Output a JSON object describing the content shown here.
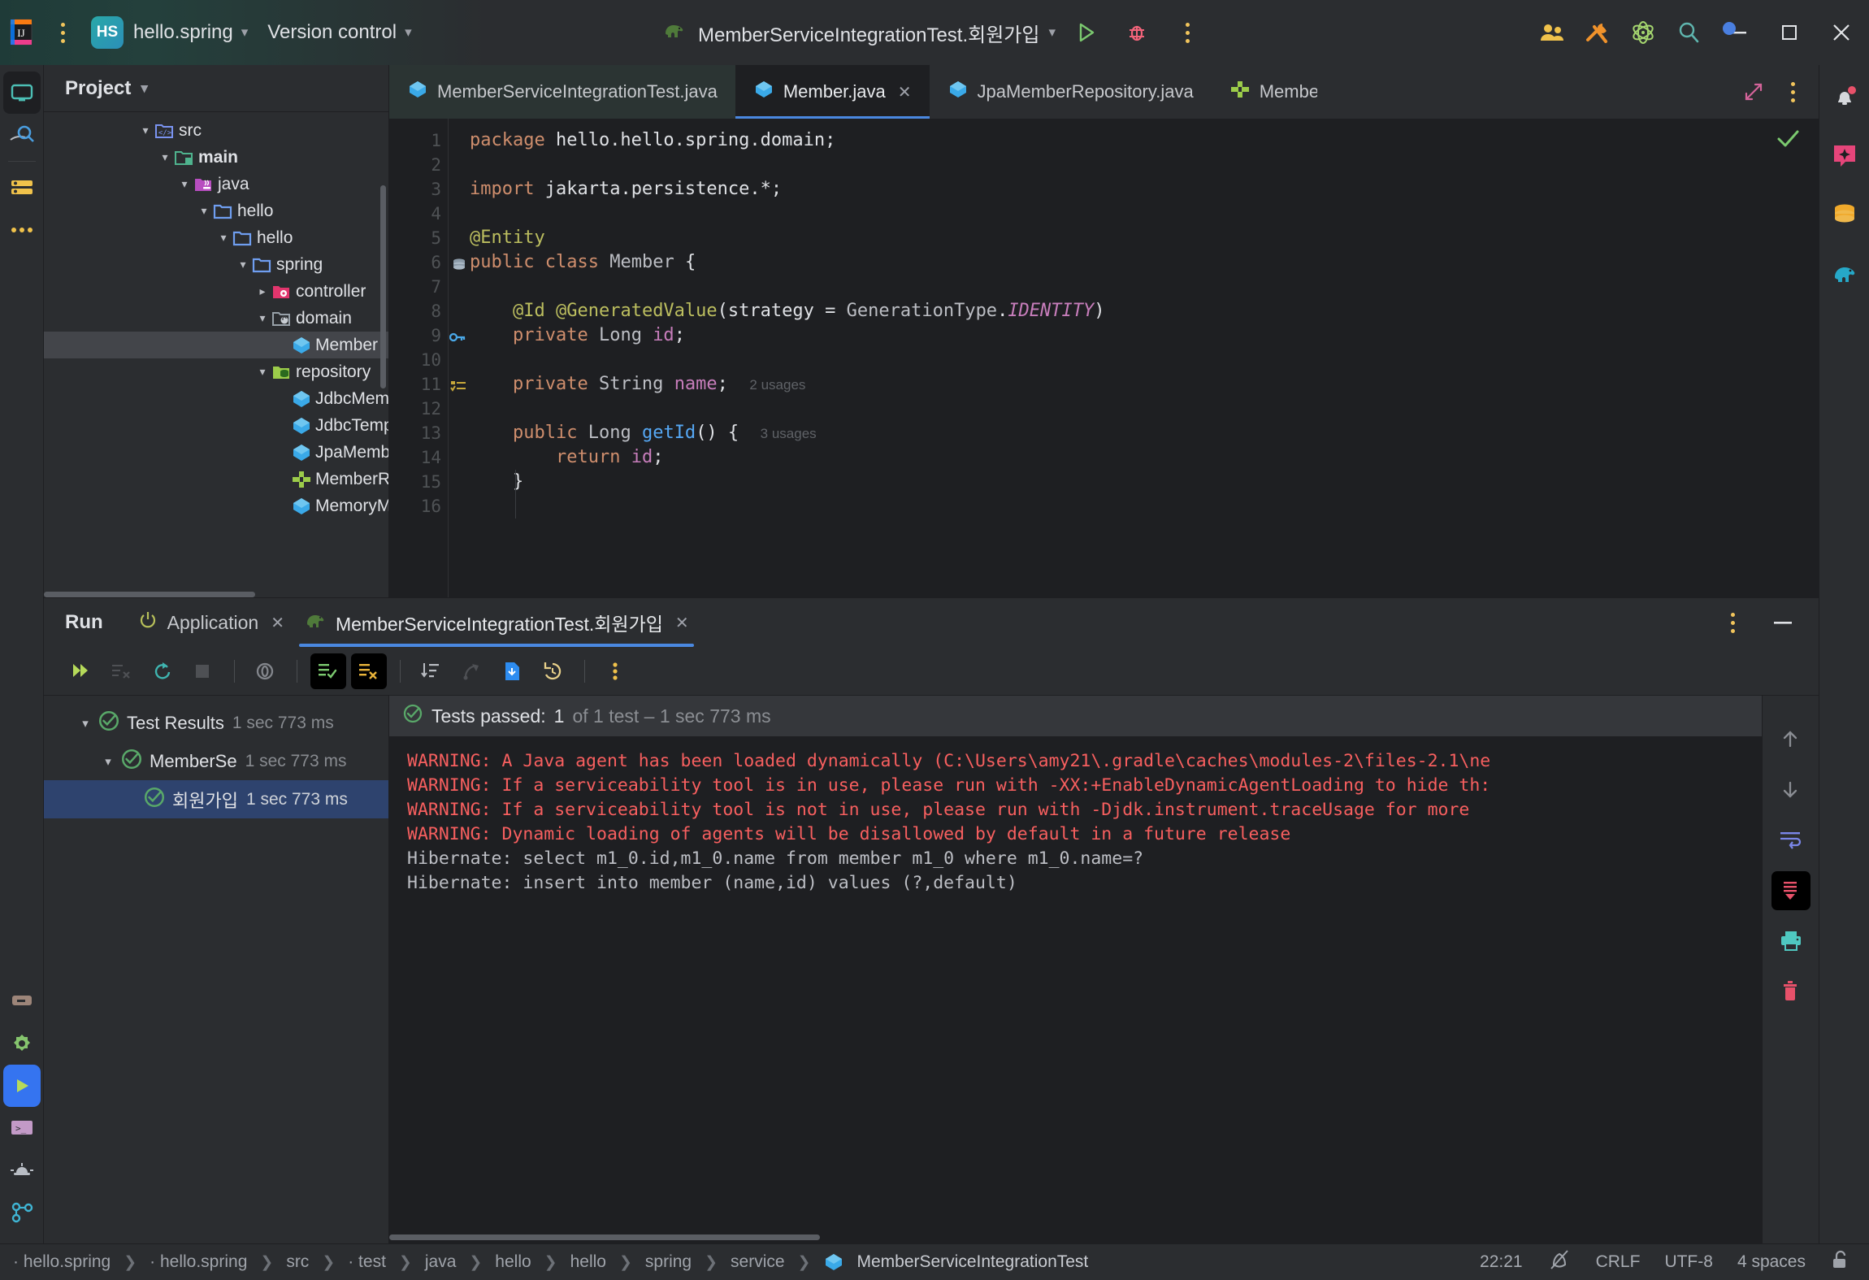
{
  "titlebar": {
    "project_initials": "HS",
    "project_name": "hello.spring",
    "version_control": "Version control",
    "run_config": "MemberServiceIntegrationTest.회원가입",
    "icons": {
      "app_logo": "intellij-logo-icon",
      "main_menu": "hamburger-menu-icon",
      "run": "run-icon",
      "debug": "debug-icon",
      "more": "more-vertical-icon",
      "collab": "collaborate-icon",
      "settings": "tools-icon",
      "plugin": "atom-plugin-icon",
      "search": "search-icon",
      "minimize": "minimize-icon",
      "maximize": "maximize-icon",
      "close": "close-icon"
    }
  },
  "project_panel": {
    "title": "Project",
    "tree": [
      {
        "label": "src",
        "indent": 4,
        "arrow": "down",
        "icon": "src-folder-icon",
        "bold": false,
        "selected": false
      },
      {
        "label": "main",
        "indent": 5,
        "arrow": "down",
        "icon": "main-folder-icon",
        "bold": true,
        "selected": false
      },
      {
        "label": "java",
        "indent": 6,
        "arrow": "down",
        "icon": "java-folder-icon",
        "bold": false,
        "selected": false
      },
      {
        "label": "hello",
        "indent": 7,
        "arrow": "down",
        "icon": "package-folder-icon",
        "bold": false,
        "selected": false
      },
      {
        "label": "hello",
        "indent": 8,
        "arrow": "down",
        "icon": "package-folder-icon",
        "bold": false,
        "selected": false
      },
      {
        "label": "spring",
        "indent": 9,
        "arrow": "down",
        "icon": "package-folder-icon",
        "bold": false,
        "selected": false
      },
      {
        "label": "controller",
        "indent": 10,
        "arrow": "right",
        "icon": "controller-folder-icon",
        "bold": false,
        "selected": false
      },
      {
        "label": "domain",
        "indent": 10,
        "arrow": "down",
        "icon": "domain-folder-icon",
        "bold": false,
        "selected": false
      },
      {
        "label": "Member",
        "indent": 11,
        "arrow": "none",
        "icon": "java-class-icon",
        "bold": false,
        "selected": true
      },
      {
        "label": "repository",
        "indent": 10,
        "arrow": "down",
        "icon": "repository-folder-icon",
        "bold": false,
        "selected": false
      },
      {
        "label": "JdbcMemberRepo",
        "indent": 11,
        "arrow": "none",
        "icon": "java-class-icon",
        "bold": false,
        "selected": false
      },
      {
        "label": "JdbcTemplateMem",
        "indent": 11,
        "arrow": "none",
        "icon": "java-class-icon",
        "bold": false,
        "selected": false
      },
      {
        "label": "JpaMemberRepos",
        "indent": 11,
        "arrow": "none",
        "icon": "java-class-icon",
        "bold": false,
        "selected": false
      },
      {
        "label": "MemberRepositor",
        "indent": 11,
        "arrow": "none",
        "icon": "java-interface-icon",
        "bold": false,
        "selected": false
      },
      {
        "label": "MemoryMemberR",
        "indent": 11,
        "arrow": "none",
        "icon": "java-class-icon",
        "bold": false,
        "selected": false
      }
    ]
  },
  "editor": {
    "tabs": [
      {
        "label": "MemberServiceIntegrationTest.java",
        "icon": "java-class-icon",
        "active": false,
        "modified_bg": true,
        "closable": false
      },
      {
        "label": "Member.java",
        "icon": "java-class-icon",
        "active": true,
        "modified_bg": false,
        "closable": true
      },
      {
        "label": "JpaMemberRepository.java",
        "icon": "java-class-icon",
        "active": false,
        "modified_bg": false,
        "closable": false
      },
      {
        "label": "MemberRepository.java",
        "icon": "java-interface-icon",
        "active": false,
        "modified_bg": false,
        "closable": false
      }
    ],
    "tab_actions": {
      "expand": "expand-editor-icon",
      "more": "more-vertical-icon"
    },
    "inspection_status": "green-checkmark-icon",
    "lines": [
      {
        "n": 1,
        "gutter": "",
        "text": "package hello.hello.spring.domain;"
      },
      {
        "n": 2,
        "gutter": "",
        "text": ""
      },
      {
        "n": 3,
        "gutter": "",
        "text": "import jakarta.persistence.*;"
      },
      {
        "n": 4,
        "gutter": "",
        "text": ""
      },
      {
        "n": 5,
        "gutter": "",
        "text": "@Entity"
      },
      {
        "n": 6,
        "gutter": "database-icon",
        "text": "public class Member {"
      },
      {
        "n": 7,
        "gutter": "",
        "text": ""
      },
      {
        "n": 8,
        "gutter": "",
        "text": "    @Id @GeneratedValue(strategy = GenerationType.IDENTITY)"
      },
      {
        "n": 9,
        "gutter": "key-icon",
        "text": "    private Long id;"
      },
      {
        "n": 10,
        "gutter": "",
        "text": ""
      },
      {
        "n": 11,
        "gutter": "column-icon",
        "text": "    private String name;",
        "usages": "2 usages"
      },
      {
        "n": 12,
        "gutter": "",
        "text": ""
      },
      {
        "n": 13,
        "gutter": "",
        "text": "    public Long getId() {",
        "usages": "3 usages"
      },
      {
        "n": 14,
        "gutter": "",
        "text": "        return id;"
      },
      {
        "n": 15,
        "gutter": "",
        "text": "    }"
      },
      {
        "n": 16,
        "gutter": "",
        "text": ""
      }
    ]
  },
  "run_panel": {
    "title": "Run",
    "tabs": [
      {
        "label": "Application",
        "icon": "power-icon",
        "active": false,
        "closable": true
      },
      {
        "label": "MemberServiceIntegrationTest.회원가입",
        "icon": "gradle-elephant-icon",
        "active": true,
        "closable": true
      }
    ],
    "header_actions": {
      "more": "more-vertical-icon",
      "minimize": "minimize-panel-icon"
    },
    "toolbar": [
      {
        "name": "rerun-icon",
        "state": "normal"
      },
      {
        "name": "rerun-failed-tests-icon",
        "state": "disabled"
      },
      {
        "name": "toggle-auto-test-icon",
        "state": "normal"
      },
      {
        "name": "stop-icon",
        "state": "disabled"
      },
      {
        "name": "sep",
        "state": "sep"
      },
      {
        "name": "coverage-icon",
        "state": "normal"
      },
      {
        "name": "sep",
        "state": "sep"
      },
      {
        "name": "show-passed-icon",
        "state": "on"
      },
      {
        "name": "show-ignored-icon",
        "state": "on"
      },
      {
        "name": "sep",
        "state": "sep"
      },
      {
        "name": "sort-alphabetically-icon",
        "state": "normal"
      },
      {
        "name": "expand-test-icon",
        "state": "disabled"
      },
      {
        "name": "export-test-results-icon",
        "state": "normal"
      },
      {
        "name": "test-history-icon",
        "state": "normal"
      },
      {
        "name": "sep",
        "state": "sep"
      },
      {
        "name": "more-vertical-icon",
        "state": "normal"
      }
    ],
    "test_tree": [
      {
        "label": "Test Results",
        "time": "1 sec 773 ms",
        "indent": 1,
        "arrow": "down",
        "icon": "test-passed-icon",
        "selected": false
      },
      {
        "label": "MemberSe",
        "time": "1 sec 773 ms",
        "indent": 2,
        "arrow": "down",
        "icon": "test-passed-icon",
        "selected": false
      },
      {
        "label": "회원가입",
        "time": "1 sec 773 ms",
        "indent": 3,
        "arrow": "none",
        "icon": "test-passed-icon",
        "selected": true
      }
    ],
    "console_status": {
      "icon": "test-passed-icon",
      "label": "Tests passed:",
      "count": "1",
      "of_text": "of 1 test – 1 sec 773 ms"
    },
    "console_lines": [
      {
        "type": "warn",
        "text": "WARNING: A Java agent has been loaded dynamically (C:\\Users\\amy21\\.gradle\\caches\\modules-2\\files-2.1\\ne"
      },
      {
        "type": "warn",
        "text": "WARNING: If a serviceability tool is in use, please run with -XX:+EnableDynamicAgentLoading to hide th:"
      },
      {
        "type": "warn",
        "text": "WARNING: If a serviceability tool is not in use, please run with -Djdk.instrument.traceUsage for more "
      },
      {
        "type": "warn",
        "text": "WARNING: Dynamic loading of agents will be disallowed by default in a future release"
      },
      {
        "type": "norm",
        "text": "Hibernate: select m1_0.id,m1_0.name from member m1_0 where m1_0.name=?"
      },
      {
        "type": "norm",
        "text": "Hibernate: insert into member (name,id) values (?,default)"
      }
    ],
    "console_rail": [
      {
        "name": "scroll-up-icon",
        "state": "normal"
      },
      {
        "name": "scroll-down-icon",
        "state": "normal"
      },
      {
        "name": "soft-wrap-icon",
        "state": "normal"
      },
      {
        "name": "scroll-to-end-icon",
        "state": "on"
      },
      {
        "name": "print-icon",
        "state": "normal"
      },
      {
        "name": "clear-all-icon",
        "state": "normal"
      }
    ]
  },
  "left_rail": [
    {
      "name": "project-tool-window-icon",
      "active": true
    },
    {
      "name": "search-everywhere-icon",
      "active": false
    },
    {
      "name": "commit-icon",
      "active": false
    },
    {
      "name": "more-tool-windows-icon",
      "active": false
    }
  ],
  "left_rail_bottom": [
    {
      "name": "build-icon",
      "active": false
    },
    {
      "name": "services-icon",
      "active": false
    },
    {
      "name": "run-tool-window-icon",
      "active": true
    },
    {
      "name": "terminal-icon",
      "active": false
    },
    {
      "name": "problems-icon",
      "active": false
    },
    {
      "name": "version-control-icon",
      "active": false
    }
  ],
  "right_rail": [
    {
      "name": "notifications-bell-icon",
      "badge": true
    },
    {
      "name": "ai-assistant-icon",
      "badge": false
    },
    {
      "name": "database-icon",
      "badge": false
    },
    {
      "name": "gradle-elephant-icon",
      "badge": false
    }
  ],
  "statusbar": {
    "breadcrumbs": [
      "hello.spring",
      "hello.spring",
      "src",
      "test",
      "java",
      "hello",
      "hello",
      "spring",
      "service",
      "MemberServiceIntegrationTest"
    ],
    "last_crumb_icon": "java-class-icon",
    "caret_position": "22:21",
    "inspection_icon": "inspections-off-icon",
    "line_separator": "CRLF",
    "encoding": "UTF-8",
    "indent": "4 spaces",
    "lock_icon": "unlocked-icon"
  },
  "colors": {
    "accent_blue": "#4a88e0",
    "selection_blue": "#2e436e",
    "panel_bg": "#2b2d30",
    "editor_bg": "#1e1f22",
    "warn_red": "#f75f5f",
    "pass_green": "#59a869"
  }
}
